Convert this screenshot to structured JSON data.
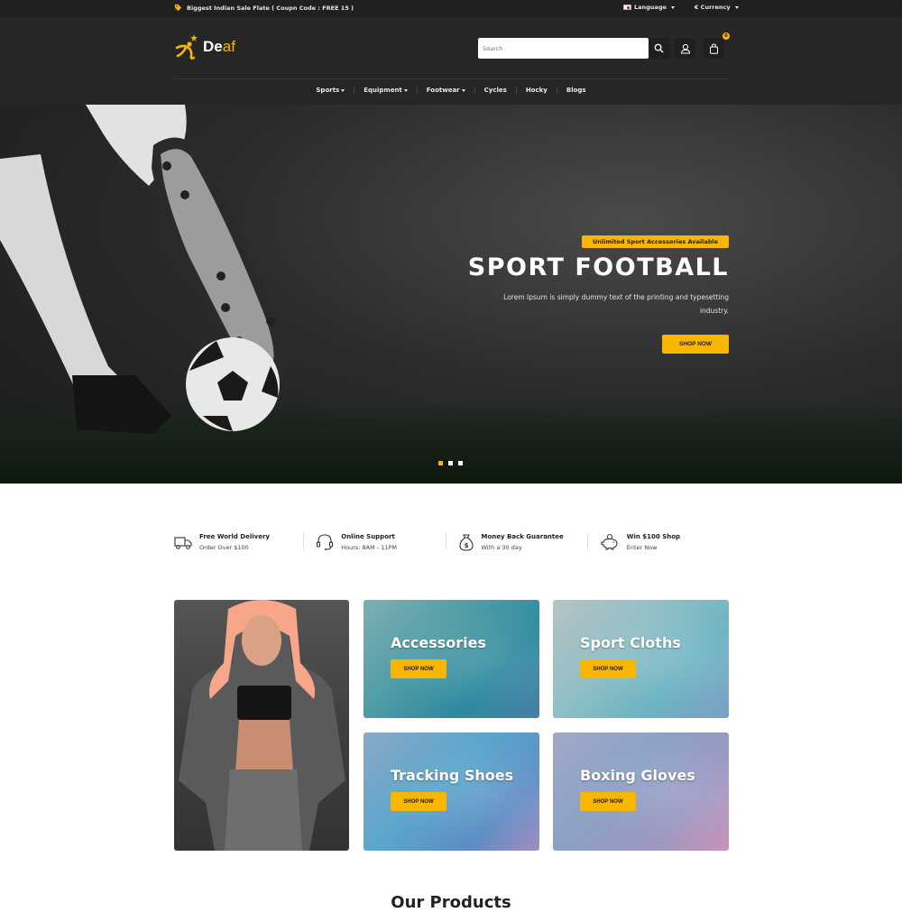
{
  "topbar": {
    "promo_text": "Biggest Indian Sale Flate ( Coupn Code : FREE 15 )",
    "language_label": "Language",
    "currency_label": "€ Currency"
  },
  "header": {
    "logo_main": "De",
    "logo_accent": "af",
    "search_placeholder": "Search",
    "cart_count": "0"
  },
  "nav": {
    "items": [
      {
        "label": "Sports",
        "dropdown": true
      },
      {
        "label": "Equipment",
        "dropdown": true
      },
      {
        "label": "Footwear",
        "dropdown": true
      },
      {
        "label": "Cycles",
        "dropdown": false
      },
      {
        "label": "Hocky",
        "dropdown": false
      },
      {
        "label": "Blogs",
        "dropdown": false
      }
    ]
  },
  "hero": {
    "badge": "Unlimited Sport Accessories Available",
    "title": "SPORT FOOTBALL",
    "description": "Lorem Ipsum is simply dummy text of the printing and typesetting industry.",
    "button_label": "SHOP NOW",
    "slides": 3,
    "active_slide": 1
  },
  "features": [
    {
      "icon": "truck-icon",
      "title": "Free World Delivery",
      "subtitle": "Order Over $100"
    },
    {
      "icon": "headset-icon",
      "title": "Online Support",
      "subtitle": "Hours: 8AM - 11PM"
    },
    {
      "icon": "money-bag-icon",
      "title": "Money Back Guarantee",
      "subtitle": "With a 30 day"
    },
    {
      "icon": "piggy-bank-icon",
      "title": "Win $100 Shop",
      "subtitle": "Enter Now"
    }
  ],
  "categories": [
    {
      "title": "Accessories",
      "button": "SHOP NOW"
    },
    {
      "title": "Sport Cloths",
      "button": "SHOP NOW"
    },
    {
      "title": "Tracking Shoes",
      "button": "SHOP NOW"
    },
    {
      "title": "Boxing Gloves",
      "button": "SHOP NOW"
    }
  ],
  "section": {
    "title": "Our Products"
  },
  "colors": {
    "accent": "#f9b600",
    "topbar_bg": "#202020",
    "header_bg": "#262626"
  }
}
